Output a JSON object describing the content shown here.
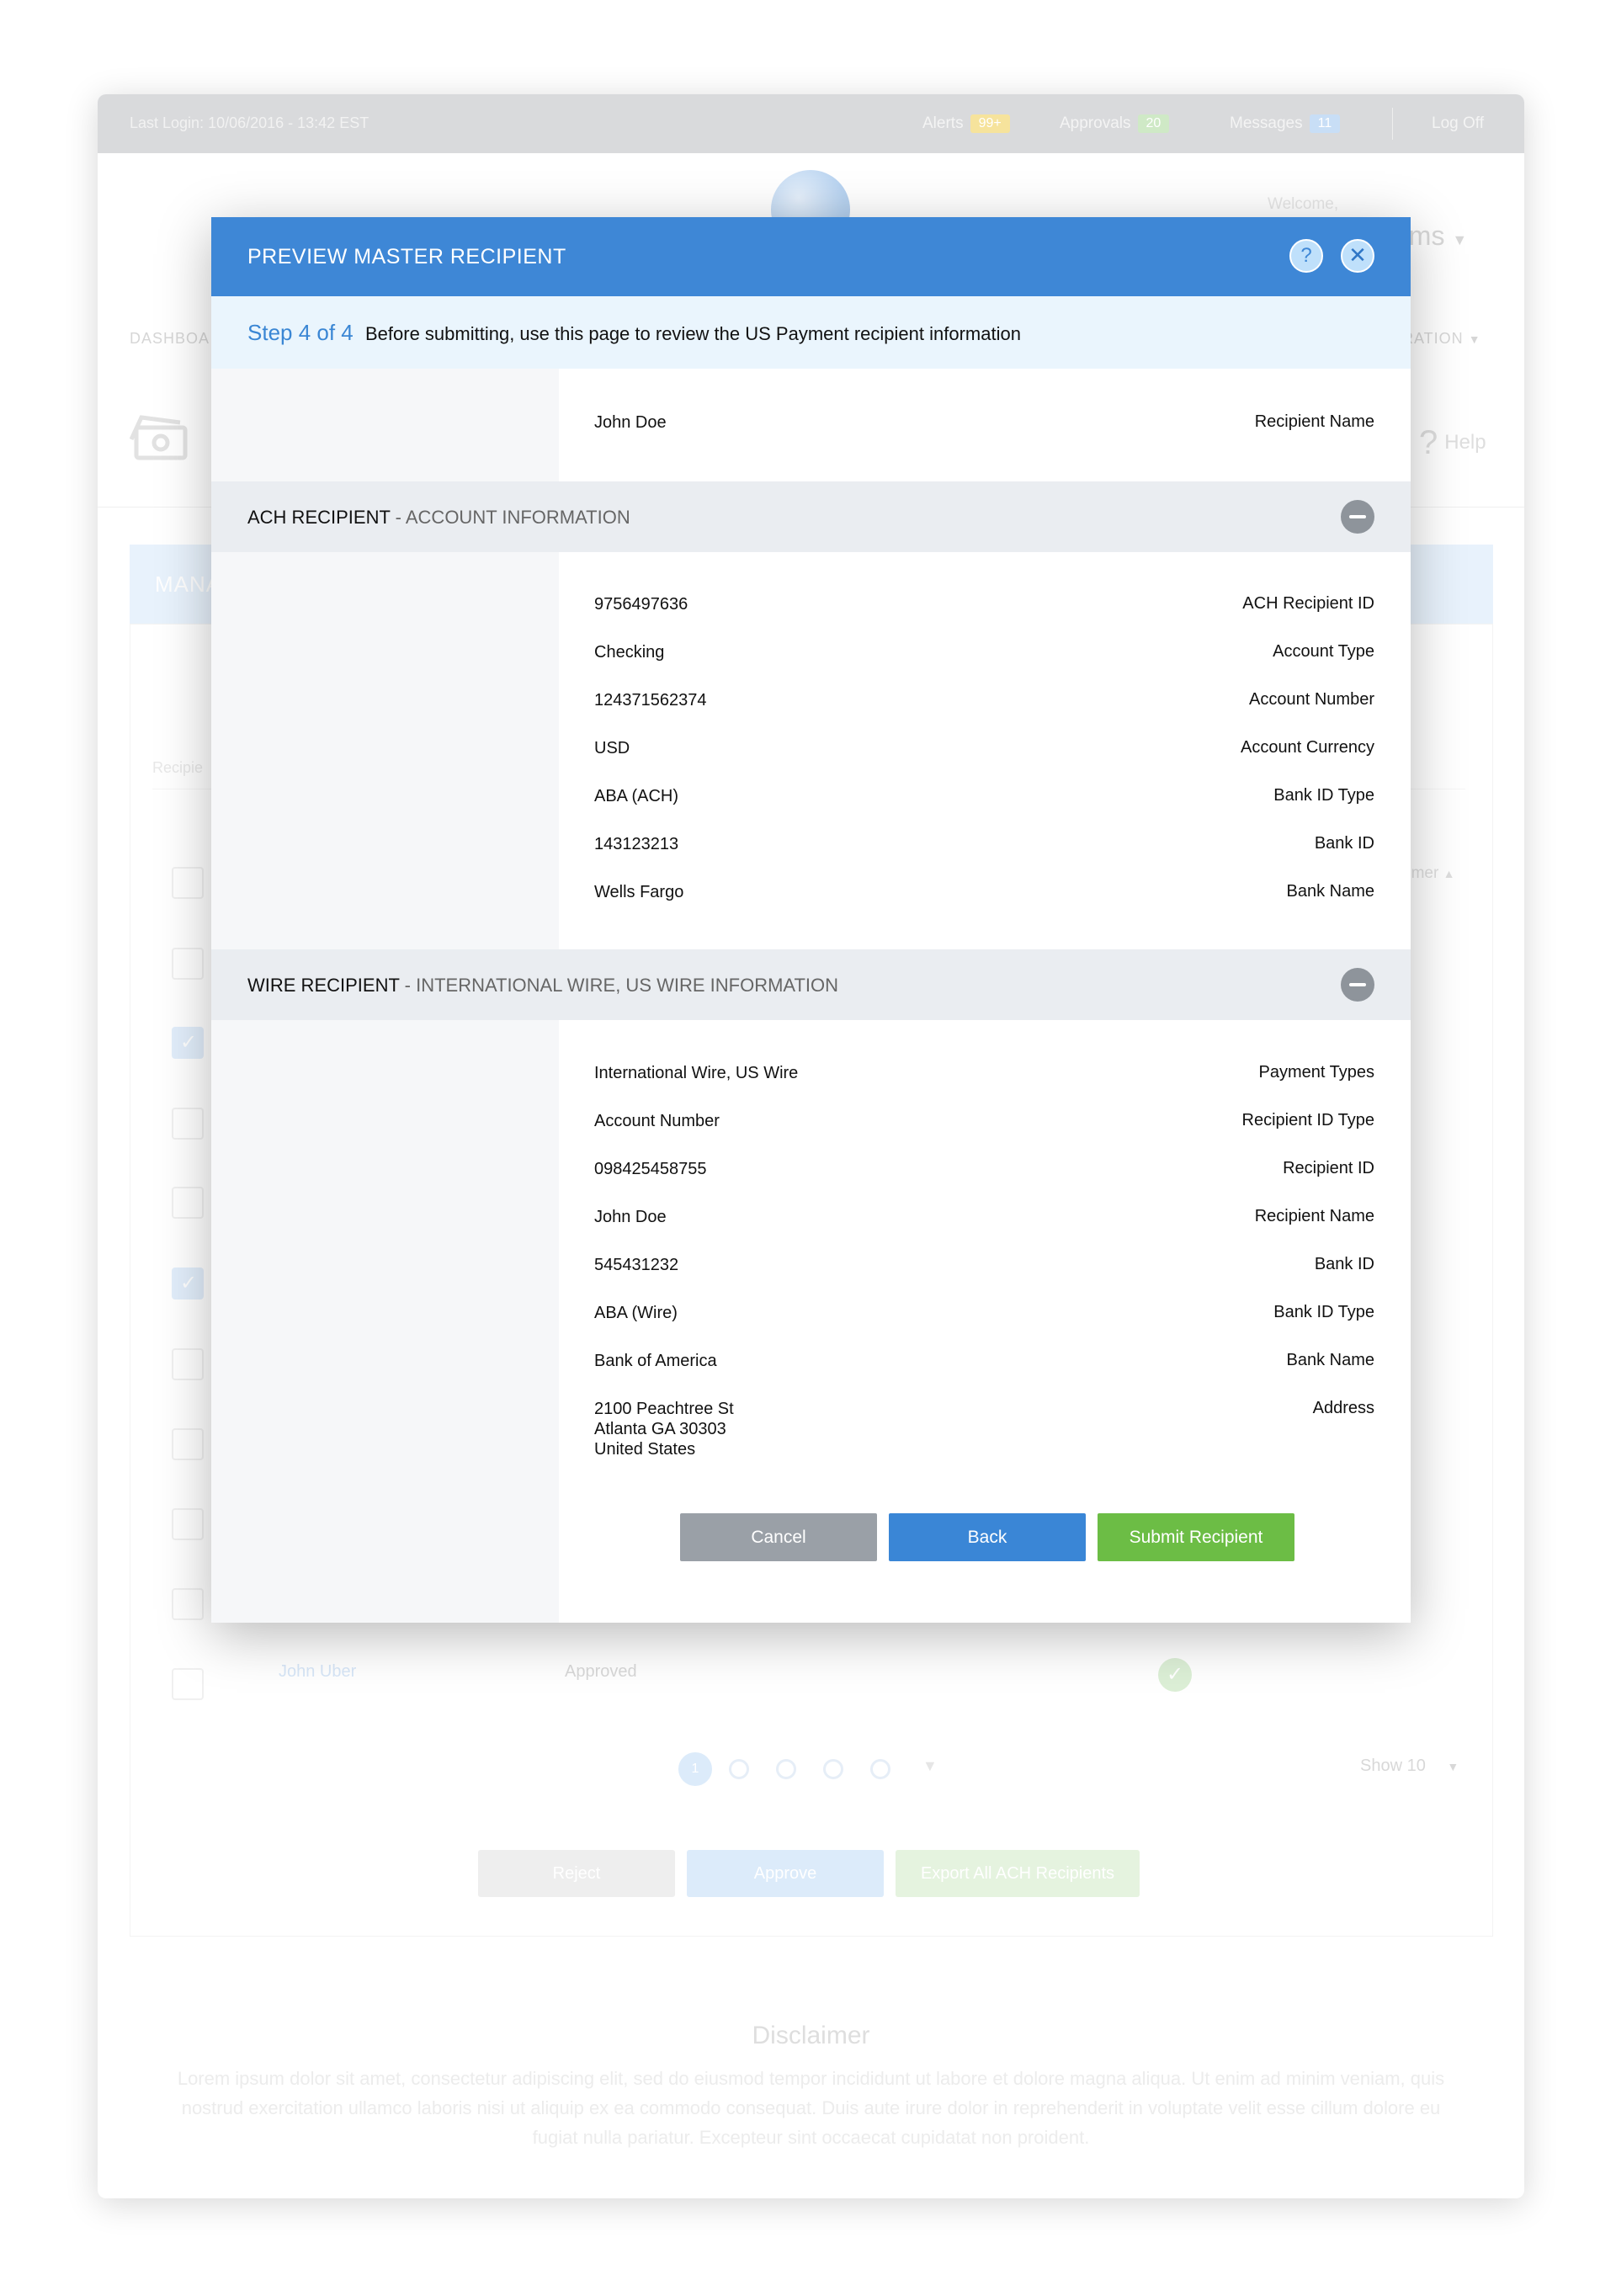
{
  "topbar": {
    "last_login": "Last Login: 10/06/2016 - 13:42 EST",
    "alerts_label": "Alerts",
    "alerts_count": "99+",
    "approvals_label": "Approvals",
    "approvals_count": "20",
    "messages_label": "Messages",
    "messages_count": "11",
    "logoff_label": "Log Off",
    "colors": {
      "alerts": "#f6e39c",
      "approvals": "#cfe9c6",
      "messages": "#c8def6"
    }
  },
  "header": {
    "welcome_label": "Welcome,",
    "user_name_fragment": "ams",
    "nav_left_fragment": "DASHBOA",
    "nav_right_fragment": "RATION",
    "help_label": "Help"
  },
  "background": {
    "section_fragment": "MANA",
    "filter_fragment": "Recipie",
    "sort_col_fragment": "omer",
    "last_row": {
      "name": "John Uber",
      "status": "Approved"
    },
    "pages": [
      "1"
    ],
    "show_label": "Show 10",
    "buttons": {
      "reject": "Reject",
      "approve": "Approve",
      "export": "Export All ACH Recipients"
    },
    "disclaimer_title": "Disclaimer",
    "disclaimer_text": "Lorem ipsum dolor sit amet, consectetur adipiscing elit, sed do eiusmod tempor incididunt ut labore et dolore magna aliqua. Ut enim ad minim veniam, quis nostrud exercitation ullamco laboris nisi ut aliquip ex ea commodo consequat. Duis aute irure dolor in reprehenderit in voluptate velit esse cillum dolore eu fugiat nulla pariatur. Excepteur sint occaecat cupidatat non proident."
  },
  "modal": {
    "title": "PREVIEW MASTER RECIPIENT",
    "step_label": "Step 4 of 4",
    "step_text": "Before submitting, use this page to review the US Payment recipient information",
    "recipient_name_label": "Recipient Name",
    "recipient_name_value": "John Doe",
    "ach_section": {
      "title": "ACH RECIPIENT",
      "subtitle": "- ACCOUNT INFORMATION",
      "fields": [
        {
          "label": "ACH Recipient ID",
          "value": "9756497636"
        },
        {
          "label": "Account Type",
          "value": "Checking"
        },
        {
          "label": "Account Number",
          "value": "124371562374"
        },
        {
          "label": "Account Currency",
          "value": "USD"
        },
        {
          "label": "Bank ID Type",
          "value": "ABA (ACH)"
        },
        {
          "label": "Bank ID",
          "value": "143123213"
        },
        {
          "label": "Bank Name",
          "value": "Wells Fargo"
        }
      ]
    },
    "wire_section": {
      "title": "WIRE RECIPIENT",
      "subtitle": "- INTERNATIONAL WIRE, US WIRE INFORMATION",
      "fields": [
        {
          "label": "Payment Types",
          "value": "International Wire, US Wire"
        },
        {
          "label": "Recipient ID Type",
          "value": "Account Number"
        },
        {
          "label": "Recipient ID",
          "value": "098425458755"
        },
        {
          "label": "Recipient Name",
          "value": "John Doe"
        },
        {
          "label": "Bank ID",
          "value": "545431232"
        },
        {
          "label": "Bank ID Type",
          "value": "ABA (Wire)"
        },
        {
          "label": "Bank Name",
          "value": "Bank of America"
        }
      ],
      "address_label": "Address",
      "address_lines": [
        "2100 Peachtree St",
        "Atlanta GA 30303",
        "United States"
      ]
    },
    "buttons": {
      "cancel": "Cancel",
      "back": "Back",
      "submit": "Submit Recipient"
    },
    "colors": {
      "header": "#3e87d6",
      "cancel": "#9aa0a7",
      "back": "#3a86d6",
      "submit": "#6cbd45"
    }
  }
}
